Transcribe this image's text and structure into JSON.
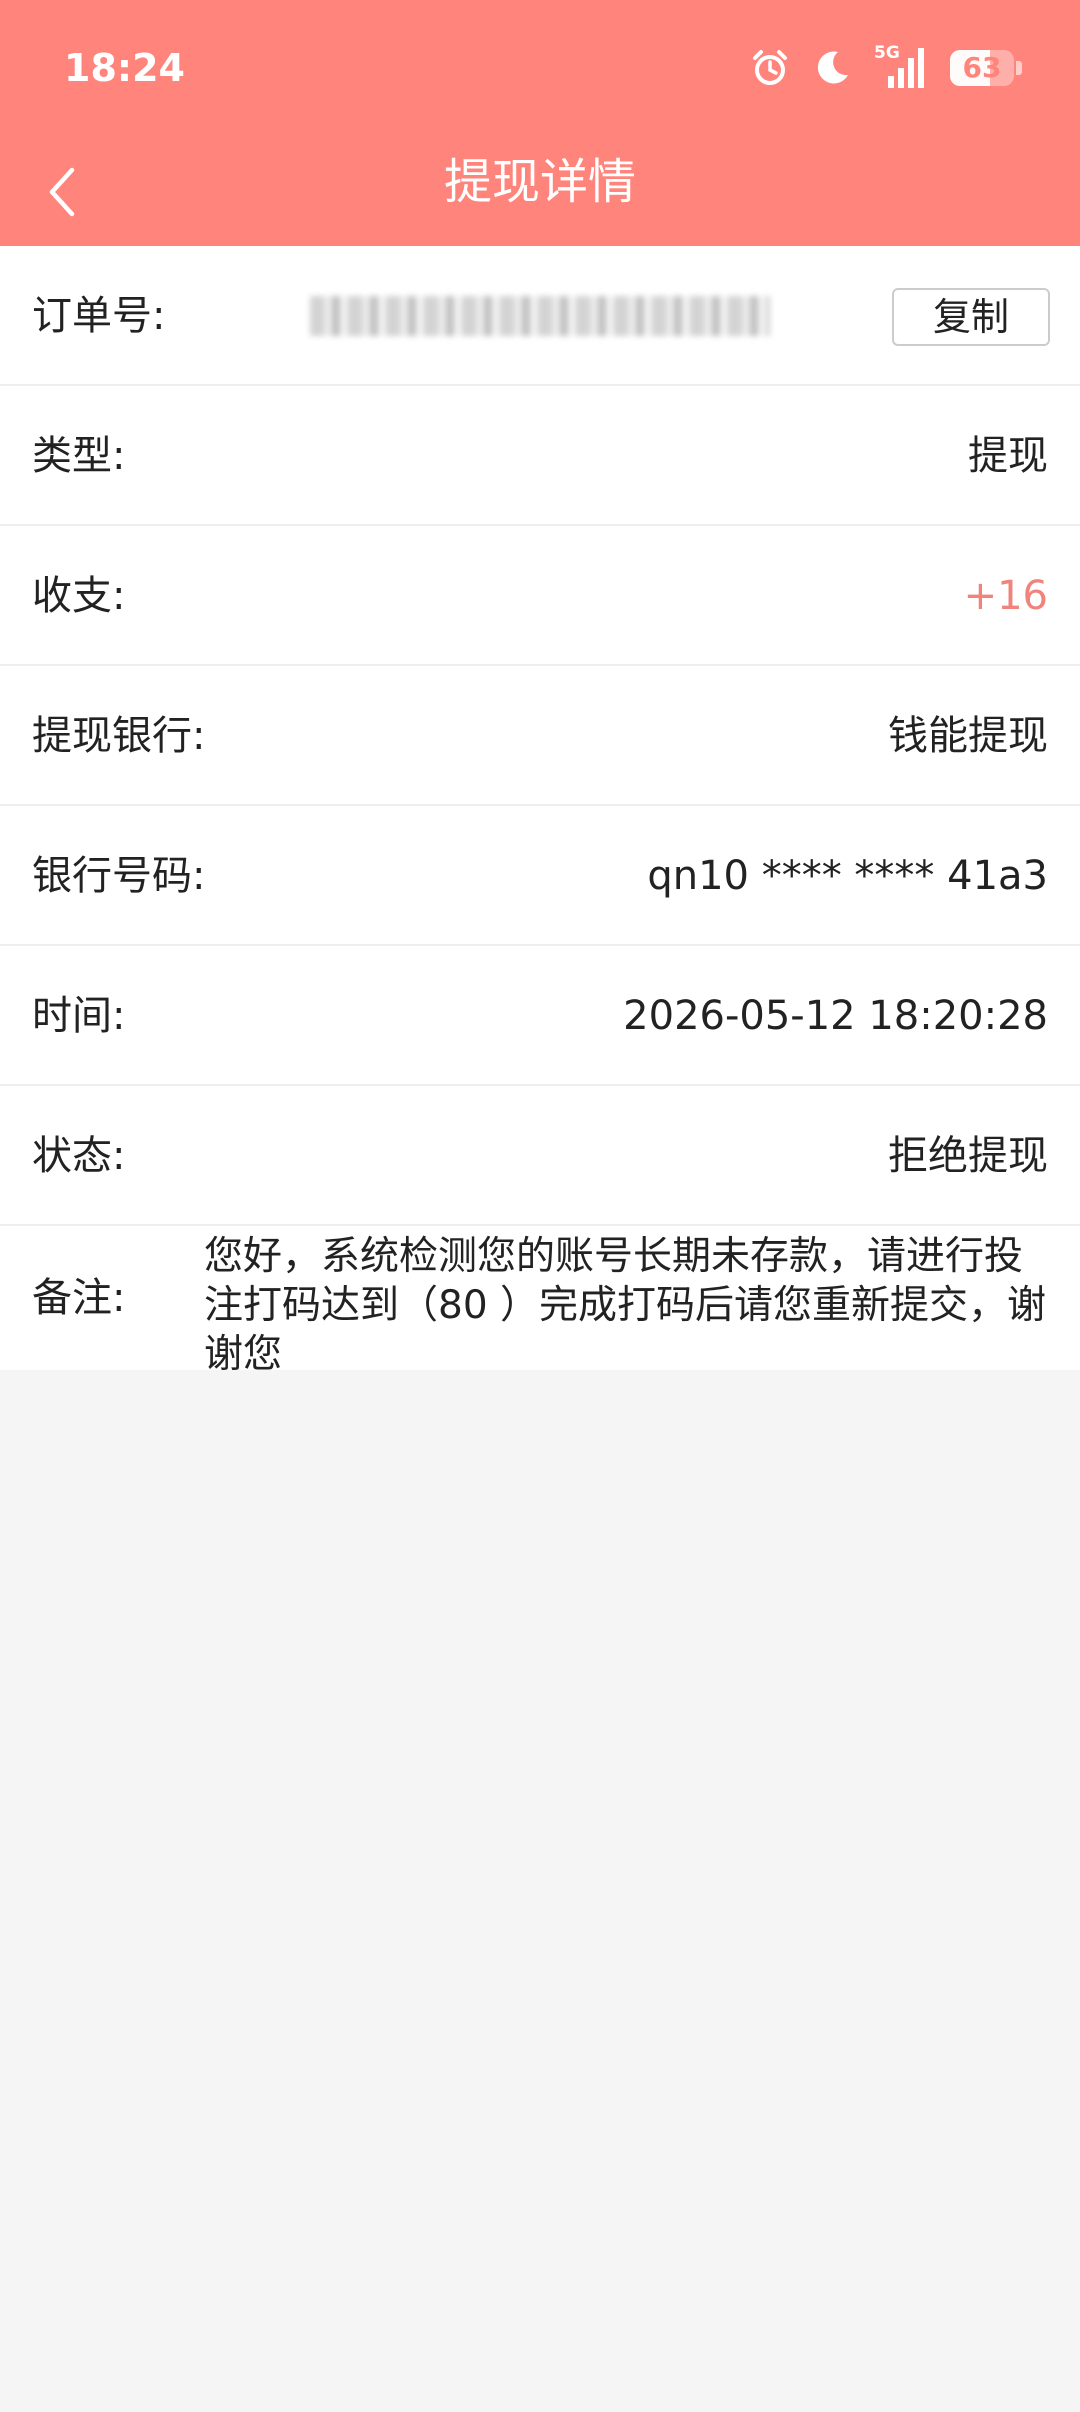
{
  "status_bar": {
    "time": "18:24",
    "network": "5G",
    "battery": "63",
    "battery_level_percent": 63,
    "icons": [
      "alarm-icon",
      "moon-icon",
      "signal-5g-icon",
      "battery-icon"
    ]
  },
  "header": {
    "title": "提现详情",
    "back_icon": "chevron-left-icon",
    "background_color": "#ff847b"
  },
  "details": {
    "order": {
      "label": "订单号:",
      "copy_label": "复制"
    },
    "type": {
      "label": "类型:",
      "value": "提现"
    },
    "income": {
      "label": "收支:",
      "value": "+16",
      "color": "#f0837c"
    },
    "bank": {
      "label": "提现银行:",
      "value": "钱能提现"
    },
    "bank_number": {
      "label": "银行号码:",
      "value": "qn10 **** **** 41a3"
    },
    "time": {
      "label": "时间:",
      "value": "2026-05-12 18:20:28"
    },
    "status": {
      "label": "状态:",
      "value": "拒绝提现"
    },
    "remark": {
      "label": "备注:",
      "value": "您好，系统检测您的账号长期未存款，请进行投注打码达到（80 ）完成打码后请您重新提交，谢谢您"
    }
  }
}
